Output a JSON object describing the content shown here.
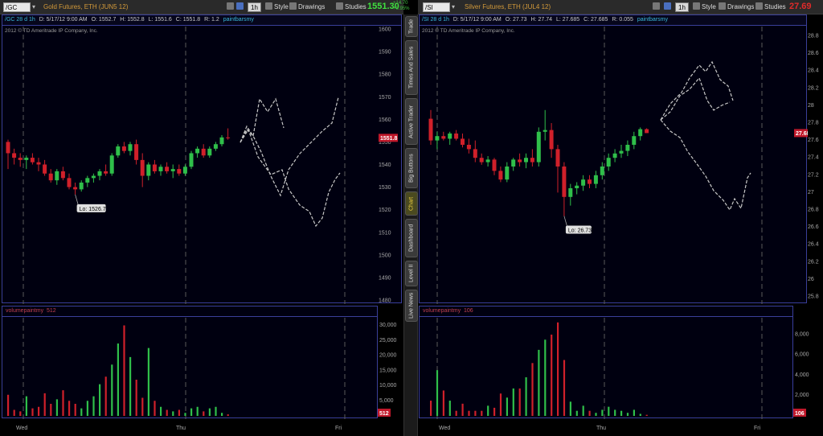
{
  "left": {
    "symbol": "/GC",
    "description": "Gold Futures, ETH (JUN5 12)",
    "interval": "1h",
    "style_label": "Style",
    "drawings_label": "Drawings",
    "studies_label": "Studies",
    "last_price": "1551.30",
    "change": "+14.70",
    "change_pct": "+0.95%",
    "last_price_color": "#3fe03f",
    "info": {
      "period": "/GC 28 d 1h",
      "date": "D: 5/17/12 9:00 AM",
      "open": "O: 1552.7",
      "high": "H: 1552.8",
      "low": "L: 1551.6",
      "close": "C: 1551.8",
      "range": "R: 1.2",
      "study": "paintbarsmy"
    },
    "copyright": "2012 © TD Ameritrade IP Company, Inc.",
    "lo_label": "Lo: 1526.7",
    "price_badge": "1551.8",
    "price_ticks": [
      "1600",
      "1590",
      "1580",
      "1570",
      "1560",
      "1550",
      "1540",
      "1530",
      "1520",
      "1510",
      "1500",
      "1490",
      "1480"
    ],
    "volume_study": "volumepaintmy",
    "volume_value": "512",
    "volume_badge": "512",
    "volume_ticks": [
      "30,000",
      "25,000",
      "20,000",
      "15,000",
      "10,000",
      "5,000"
    ],
    "days": [
      "Wed",
      "Thu",
      "Fri"
    ]
  },
  "right": {
    "symbol": "/SI",
    "description": "Silver Futures, ETH (JUL4 12)",
    "interval": "1h",
    "style_label": "Style",
    "drawings_label": "Drawings",
    "studies_label": "Studies",
    "last_price": "27.69",
    "last_price_color": "#e02a2a",
    "info": {
      "period": "/SI 28 d 1h",
      "date": "D: 5/17/12 9:00 AM",
      "open": "O: 27.73",
      "high": "H: 27.74",
      "low": "L: 27.685",
      "close": "C: 27.685",
      "range": "R: 0.055",
      "study": "paintbarsmy"
    },
    "copyright": "2012 © TD Ameritrade IP Company, Inc.",
    "lo_label": "Lo: 26.73",
    "price_badge": "27.685",
    "price_ticks": [
      "28.8",
      "28.6",
      "28.4",
      "28.2",
      "28",
      "27.8",
      "27.6",
      "27.4",
      "27.2",
      "27",
      "26.8",
      "26.6",
      "26.4",
      "26.2",
      "26",
      "25.8"
    ],
    "volume_study": "volumepaintmy",
    "volume_value": "106",
    "volume_badge": "106",
    "volume_ticks": [
      "8,000",
      "6,000",
      "4,000",
      "2,000"
    ],
    "days": [
      "Wed",
      "Thu",
      "Fri"
    ]
  },
  "side_tabs": [
    "Trade",
    "Times And Sales",
    "Active Trader",
    "Big Buttons",
    "Chart",
    "Dashboard",
    "Level II",
    "Live News"
  ],
  "colors": {
    "up": "#2fbf4a",
    "down": "#d0202a",
    "axis_text": "#a8a8a8",
    "frame": "#3a3f9a",
    "projection": "#c8c8c8"
  },
  "chart_data": [
    {
      "type": "candlestick",
      "title": "Gold Futures, ETH (JUN5 12)",
      "ylim": [
        1480,
        1600
      ],
      "ohlc": [
        [
          1550,
          1551,
          1538,
          1545
        ],
        [
          1545,
          1547,
          1540,
          1543
        ],
        [
          1543,
          1545,
          1539,
          1542
        ],
        [
          1542,
          1544,
          1538,
          1543
        ],
        [
          1543,
          1545,
          1540,
          1541
        ],
        [
          1541,
          1543,
          1537,
          1540
        ],
        [
          1540,
          1542,
          1535,
          1536
        ],
        [
          1536,
          1538,
          1532,
          1533
        ],
        [
          1533,
          1538,
          1531,
          1537
        ],
        [
          1537,
          1539,
          1533,
          1534
        ],
        [
          1534,
          1536,
          1529,
          1530
        ],
        [
          1530,
          1532,
          1526.7,
          1529
        ],
        [
          1529,
          1533,
          1528,
          1532
        ],
        [
          1532,
          1535,
          1530,
          1534
        ],
        [
          1534,
          1536,
          1532,
          1535
        ],
        [
          1535,
          1538,
          1533,
          1537
        ],
        [
          1537,
          1540,
          1535,
          1536
        ],
        [
          1536,
          1545,
          1535,
          1544
        ],
        [
          1544,
          1549,
          1543,
          1548
        ],
        [
          1548,
          1550,
          1545,
          1546
        ],
        [
          1546,
          1550,
          1544,
          1549
        ],
        [
          1549,
          1551,
          1540,
          1542
        ],
        [
          1542,
          1545,
          1530,
          1535
        ],
        [
          1535,
          1541,
          1533,
          1540
        ],
        [
          1540,
          1542,
          1536,
          1537
        ],
        [
          1537,
          1540,
          1535,
          1539
        ],
        [
          1539,
          1541,
          1536,
          1537
        ],
        [
          1537,
          1540,
          1534,
          1538
        ],
        [
          1538,
          1540,
          1535,
          1536
        ],
        [
          1536,
          1540,
          1535,
          1539
        ],
        [
          1539,
          1546,
          1538,
          1545
        ],
        [
          1545,
          1548,
          1543,
          1547
        ],
        [
          1547,
          1549,
          1543,
          1544
        ],
        [
          1544,
          1548,
          1543,
          1547
        ],
        [
          1547,
          1550,
          1546,
          1549
        ],
        [
          1549,
          1553,
          1548,
          1552
        ],
        [
          1552,
          1556,
          1551,
          1551.8
        ]
      ],
      "volume": [
        7000,
        2000,
        1500,
        6500,
        2500,
        3000,
        7500,
        4000,
        5500,
        8500,
        5000,
        4000,
        2500,
        5000,
        6500,
        10500,
        13000,
        17000,
        24000,
        30000,
        19500,
        12000,
        6000,
        22500,
        5000,
        3000,
        2000,
        1500,
        2000,
        1000,
        2500,
        3000,
        1500,
        2500,
        3000,
        1000,
        512
      ]
    },
    {
      "type": "candlestick",
      "title": "Silver Futures, ETH (JUL4 12)",
      "ylim": [
        25.8,
        28.8
      ],
      "ohlc": [
        [
          27.85,
          27.95,
          27.55,
          27.6
        ],
        [
          27.6,
          27.7,
          27.5,
          27.65
        ],
        [
          27.65,
          27.7,
          27.6,
          27.62
        ],
        [
          27.62,
          27.7,
          27.55,
          27.68
        ],
        [
          27.68,
          27.72,
          27.6,
          27.62
        ],
        [
          27.62,
          27.68,
          27.52,
          27.55
        ],
        [
          27.55,
          27.62,
          27.45,
          27.5
        ],
        [
          27.5,
          27.6,
          27.35,
          27.4
        ],
        [
          27.4,
          27.45,
          27.32,
          27.35
        ],
        [
          27.35,
          27.42,
          27.3,
          27.38
        ],
        [
          27.38,
          27.4,
          27.2,
          27.25
        ],
        [
          27.25,
          27.3,
          27.12,
          27.15
        ],
        [
          27.15,
          27.35,
          27.12,
          27.3
        ],
        [
          27.3,
          27.4,
          27.25,
          27.38
        ],
        [
          27.38,
          27.45,
          27.3,
          27.35
        ],
        [
          27.35,
          27.45,
          27.28,
          27.4
        ],
        [
          27.4,
          27.5,
          27.3,
          27.35
        ],
        [
          27.35,
          27.75,
          27.3,
          27.7
        ],
        [
          27.7,
          27.95,
          27.6,
          27.72
        ],
        [
          27.72,
          27.8,
          27.4,
          27.5
        ],
        [
          27.5,
          27.55,
          27.0,
          27.3
        ],
        [
          27.3,
          27.35,
          26.73,
          26.95
        ],
        [
          26.95,
          27.1,
          26.85,
          27.05
        ],
        [
          27.05,
          27.12,
          26.98,
          27.08
        ],
        [
          27.08,
          27.2,
          27.02,
          27.15
        ],
        [
          27.15,
          27.2,
          27.05,
          27.1
        ],
        [
          27.1,
          27.25,
          27.05,
          27.2
        ],
        [
          27.2,
          27.35,
          27.15,
          27.3
        ],
        [
          27.3,
          27.45,
          27.25,
          27.4
        ],
        [
          27.4,
          27.5,
          27.35,
          27.45
        ],
        [
          27.45,
          27.55,
          27.4,
          27.48
        ],
        [
          27.48,
          27.6,
          27.42,
          27.55
        ],
        [
          27.55,
          27.7,
          27.5,
          27.65
        ],
        [
          27.65,
          27.75,
          27.6,
          27.73
        ],
        [
          27.73,
          27.74,
          27.685,
          27.685
        ]
      ],
      "volume": [
        1500,
        4500,
        2500,
        1500,
        500,
        1200,
        500,
        500,
        500,
        1000,
        800,
        2200,
        1800,
        2700,
        2700,
        3800,
        5200,
        6500,
        7500,
        8000,
        9200,
        5500,
        1400,
        500,
        1000,
        500,
        300,
        600,
        900,
        600,
        500,
        300,
        600,
        200,
        106
      ]
    }
  ]
}
